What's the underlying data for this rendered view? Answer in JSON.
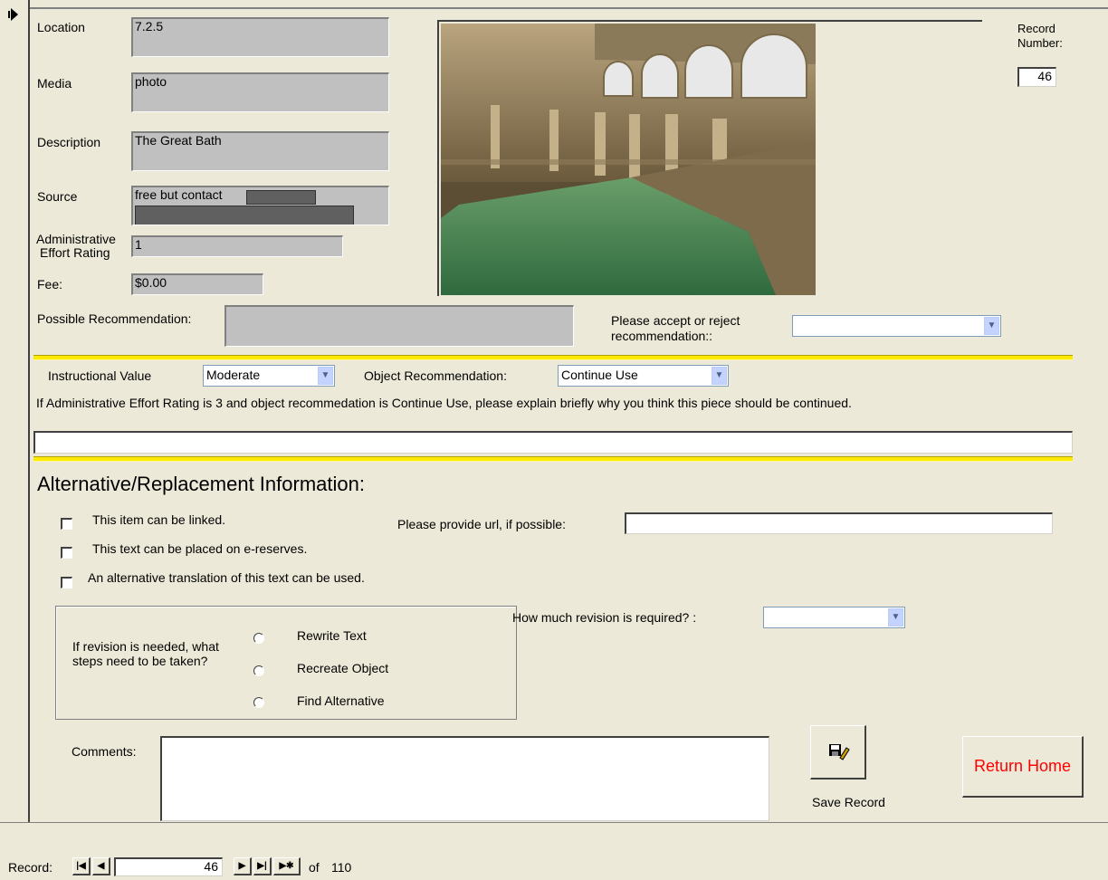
{
  "fields": {
    "location": {
      "label": "Location",
      "value": "7.2.5"
    },
    "media": {
      "label": "Media",
      "value": "photo"
    },
    "description": {
      "label": "Description",
      "value": "The Great Bath"
    },
    "source": {
      "label": "Source",
      "value": "free but contact"
    },
    "admin_effort": {
      "label_line1": "Administrative",
      "label_line2": "Effort Rating",
      "value": "1"
    },
    "fee": {
      "label": "Fee:",
      "value": "$0.00"
    },
    "possible_recommendation": {
      "label": "Possible Recommendation:",
      "value": ""
    }
  },
  "record_number": {
    "label_line1": "Record",
    "label_line2": "Number:",
    "value": "46"
  },
  "accept_reject": {
    "label_line1": "Please accept or reject",
    "label_line2": "recommendation::",
    "value": ""
  },
  "instructional_value": {
    "label": "Instructional Value",
    "value": "Moderate"
  },
  "object_recommendation": {
    "label": "Object Recommendation:",
    "value": "Continue Use"
  },
  "explain_text": "If Administrative Effort Rating is 3 and object recommedation is Continue Use, please explain briefly why you think this piece should be continued.",
  "alt_section": {
    "title": "Alternative/Replacement Information:",
    "check_linked": "This item can be linked.",
    "check_ereserves": "This text can be placed on e-reserves.",
    "check_translation": "An alternative translation of this text can be used.",
    "url_label": "Please provide url, if possible:"
  },
  "revision": {
    "question": "If revision is needed, what steps need to be taken?",
    "options": [
      "Rewrite Text",
      "Recreate Object",
      "Find Alternative"
    ],
    "how_much_label": "How much revision is required? :",
    "how_much_value": ""
  },
  "comments_label": "Comments:",
  "save_label": "Save Record",
  "return_home_label": "Return Home",
  "navigation": {
    "record_label": "Record:",
    "current": "46",
    "of_label": "of",
    "total": "110"
  },
  "colors": {
    "accent_yellow": "#ffea00",
    "return_home_text": "#ff0000",
    "form_bg": "#ece9d8"
  },
  "icons": {
    "record_selector": "record-selector-arrow-icon",
    "save": "save-disk-pencil-icon"
  }
}
